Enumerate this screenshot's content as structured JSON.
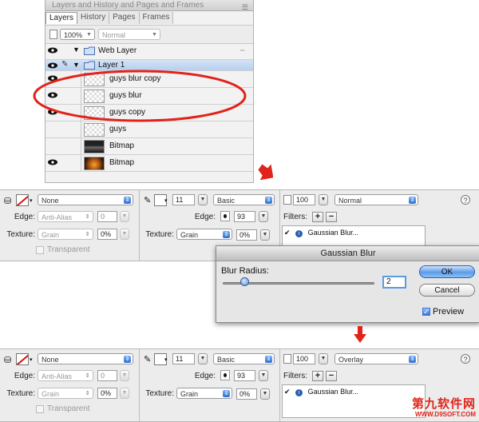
{
  "layers_panel": {
    "title": "Layers and History and Pages and Frames",
    "tabs": [
      "Layers",
      "History",
      "Pages",
      "Frames"
    ],
    "opacity": "100%",
    "blend_mode": "Normal",
    "rows": [
      {
        "name": "Web Layer",
        "kind": "folder"
      },
      {
        "name": "Layer 1",
        "kind": "folder"
      },
      {
        "name": "guys blur copy",
        "kind": "object"
      },
      {
        "name": "guys blur",
        "kind": "object"
      },
      {
        "name": "guys copy",
        "kind": "object"
      },
      {
        "name": "guys",
        "kind": "object"
      },
      {
        "name": "Bitmap",
        "kind": "bitmap"
      },
      {
        "name": "Bitmap",
        "kind": "bitmap"
      }
    ]
  },
  "inspector_before": {
    "fill_value": "None",
    "edge_label": "Edge:",
    "edge_value": "Anti-Alias",
    "edge_amount": "0",
    "texture_label": "Texture:",
    "texture_value": "Grain",
    "texture_pct": "0%",
    "transparent_label": "Transparent",
    "stroke_size": "11",
    "stroke_type": "Basic",
    "stroke_edge_label": "Edge:",
    "stroke_edge_value": "93",
    "stroke_texture_label": "Texture:",
    "stroke_texture_value": "Grain",
    "stroke_texture_pct": "0%",
    "opacity": "100",
    "blend": "Normal",
    "filters_label": "Filters:",
    "filter_item": "Gaussian Blur...",
    "help": "?"
  },
  "inspector_after": {
    "fill_value": "None",
    "edge_label": "Edge:",
    "edge_value": "Anti-Alias",
    "edge_amount": "0",
    "texture_label": "Texture:",
    "texture_value": "Grain",
    "texture_pct": "0%",
    "transparent_label": "Transparent",
    "stroke_size": "11",
    "stroke_type": "Basic",
    "stroke_edge_label": "Edge:",
    "stroke_edge_value": "93",
    "stroke_texture_label": "Texture:",
    "stroke_texture_value": "Grain",
    "stroke_texture_pct": "0%",
    "opacity": "100",
    "blend": "Overlay",
    "filters_label": "Filters:",
    "filter_item": "Gaussian Blur...",
    "help": "?"
  },
  "gaussian_dialog": {
    "title": "Gaussian Blur",
    "blur_radius_label": "Blur Radius:",
    "blur_radius_value": "2",
    "ok": "OK",
    "cancel": "Cancel",
    "preview_label": "Preview",
    "preview_checked": true
  },
  "watermark": {
    "text": "第九软件网",
    "url": "WWW.D9SOFT.COM"
  },
  "colors": {
    "annotation_red": "#e0241b",
    "accent_blue": "#3a74d8"
  }
}
